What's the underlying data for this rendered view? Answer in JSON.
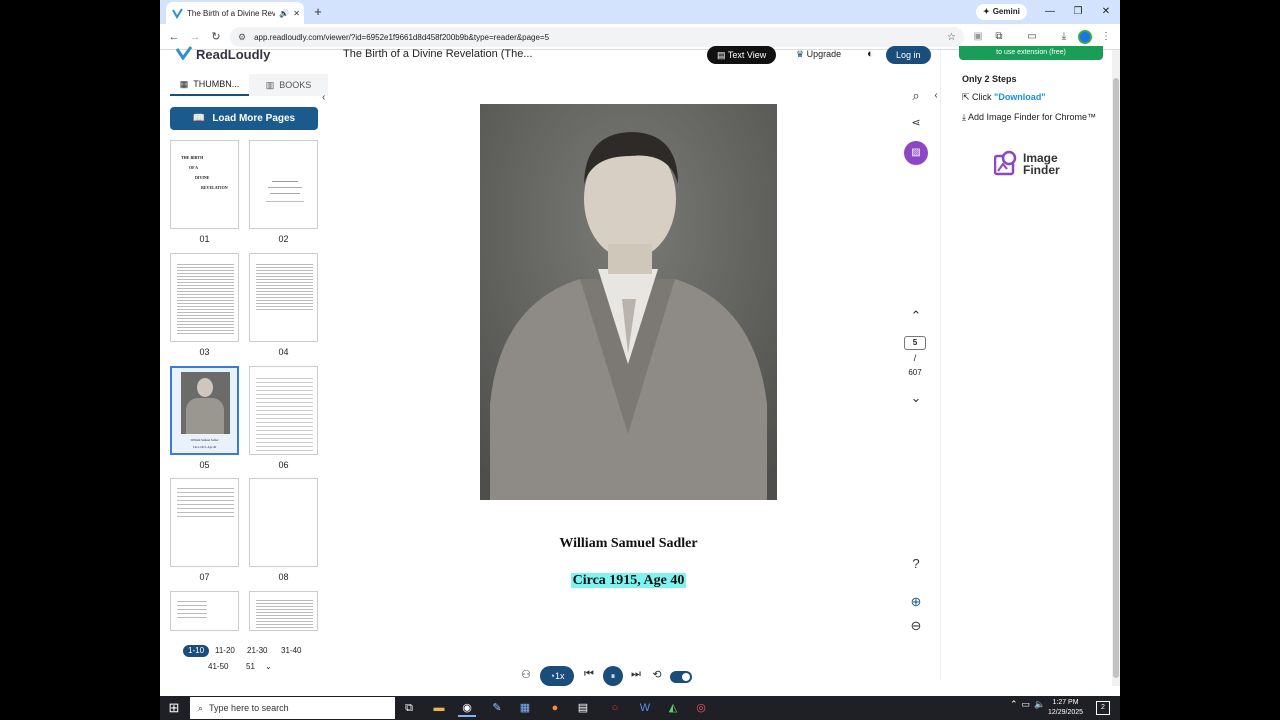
{
  "browser": {
    "tab_title": "The Birth of a Divine Revelati",
    "new_tab": "+",
    "gemini_label": "Gemini",
    "url": "app.readloudly.com/viewer/?id=6952e1f9661d8d458f200b9b&type=reader&page=5"
  },
  "app": {
    "logo_text": "ReadLoudly",
    "doc_title": "The Birth of a Divine Revelation (The...",
    "text_view_label": "Text View",
    "upgrade_label": "Upgrade",
    "login_label": "Log in"
  },
  "sidebar": {
    "tab_thumbnails": "THUMBN...",
    "tab_books": "BOOKS",
    "load_more": "Load More Pages",
    "thumbs": [
      {
        "num": "01"
      },
      {
        "num": "02"
      },
      {
        "num": "03"
      },
      {
        "num": "04"
      },
      {
        "num": "05"
      },
      {
        "num": "06"
      },
      {
        "num": "07"
      },
      {
        "num": "08"
      }
    ],
    "page_ranges": [
      "1-10",
      "11-20",
      "21-30",
      "31-40",
      "41-50",
      "51"
    ],
    "selected_range": "1-10"
  },
  "thumb_text": {
    "t1_line1": "THE BIRTH",
    "t1_line2": "OF A",
    "t1_line3": "DIVINE",
    "t1_line4": "REVELATION",
    "t5_caption1": "William Samuel Sadler",
    "t5_caption2": "Circa 1915, Age 40"
  },
  "viewer": {
    "caption_name": "William Samuel Sadler",
    "caption_circa": "Circa 1915, Age 40",
    "current_page": "5",
    "page_sep": "/",
    "total_pages": "607",
    "speed": "1x",
    "help": "?"
  },
  "extension": {
    "green_button": "to use extension (free)",
    "heading": "Only 2 Steps",
    "step1_prefix": "Click ",
    "step1_link": "\"Download\"",
    "step2": "Add Image Finder for Chrome™",
    "brand_line1": "Image",
    "brand_line2": "Finder"
  },
  "taskbar": {
    "search_placeholder": "Type here to search",
    "time": "1:27 PM",
    "date": "12/29/2025",
    "notifications": "2"
  }
}
